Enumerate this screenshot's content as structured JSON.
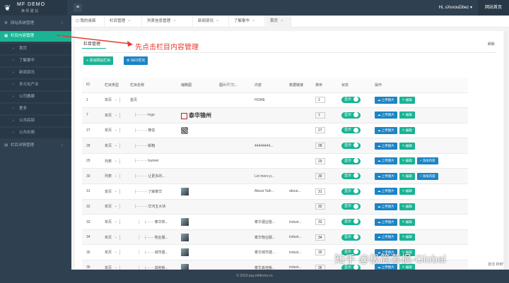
{
  "header": {
    "logo_text": "MF DEMO",
    "logo_sub": "美 帆 建 站",
    "menu_icon": "menu-icon",
    "user": "Hi, sXvxouDbez ▾",
    "site_home": "网站首页"
  },
  "sidebar": {
    "items": [
      {
        "label": "网站系统管理",
        "icon": "gear-icon",
        "arrow": "‹"
      },
      {
        "label": "栏目内容管理",
        "icon": "grid-icon",
        "arrow": "⌄"
      },
      {
        "label": "栏目详情管理",
        "icon": "list-icon",
        "arrow": "‹"
      }
    ],
    "subitems": [
      "首页",
      "了解泰华",
      "新闻资讯",
      "多元化产业",
      "公司搬建",
      "更多",
      "公共底部",
      "公共右侧"
    ]
  },
  "tabs": [
    {
      "label": "我的桌面",
      "icon": "home-icon"
    },
    {
      "label": "栏目管理"
    },
    {
      "label": "列表信息管理"
    },
    {
      "label": "新闻资讯"
    },
    {
      "label": "了解泰华"
    },
    {
      "label": "首页"
    }
  ],
  "panel": {
    "title": "栏目管理",
    "refresh": "刷新",
    "add_button": "+ 添加网站栏目",
    "seo_button": "SEO优化"
  },
  "annotation": "先点击栏目内容管理",
  "table": {
    "headers": [
      "ID",
      "栏目类型",
      "栏目名称",
      "缩略图",
      "图片尺寸(...",
      "内容",
      "数据链接",
      "排序",
      "状态",
      "操作"
    ],
    "rows": [
      {
        "id": "1",
        "type": "单页",
        "name": "首页",
        "indent": 0,
        "content": "HOME",
        "link": "",
        "sort": "1",
        "thumb": "",
        "add": false
      },
      {
        "id": "7",
        "type": "单页",
        "name": "logo",
        "indent": 1,
        "content": "",
        "link": "",
        "sort": "7",
        "thumb": "logo",
        "add": false
      },
      {
        "id": "27",
        "type": "单页",
        "name": "微信",
        "indent": 1,
        "content": "",
        "link": "",
        "sort": "27",
        "thumb": "qr",
        "add": false
      },
      {
        "id": "28",
        "type": "单页",
        "name": "邮箱",
        "indent": 1,
        "content": "44444444...",
        "link": "",
        "sort": "28",
        "thumb": "",
        "add": false
      },
      {
        "id": "29",
        "type": "列表",
        "name": "banner",
        "indent": 1,
        "content": "",
        "link": "",
        "sort": "29",
        "thumb": "",
        "add": true
      },
      {
        "id": "30",
        "type": "列表",
        "name": "让更多的...",
        "indent": 1,
        "content": "Let more p...",
        "link": "",
        "sort": "30",
        "thumb": "",
        "add": true
      },
      {
        "id": "31",
        "type": "单页",
        "name": "了解泰华",
        "indent": 1,
        "content": "About Taih...",
        "link": "about...",
        "sort": "31",
        "thumb": "photo",
        "add": false
      },
      {
        "id": "32",
        "type": "单页",
        "name": "华鸿五大块",
        "indent": 1,
        "content": "",
        "link": "",
        "sort": "32",
        "thumb": "",
        "add": false
      },
      {
        "id": "33",
        "type": "单页",
        "name": "泰华热...",
        "indent": 2,
        "content": "泰华烟业能...",
        "link": "indust...",
        "sort": "33",
        "thumb": "photo",
        "add": false
      },
      {
        "id": "34",
        "type": "单页",
        "name": "物业服...",
        "indent": 2,
        "content": "泰华物业服...",
        "link": "indust...",
        "sort": "34",
        "thumb": "photo",
        "add": false
      },
      {
        "id": "35",
        "type": "单页",
        "name": "城市建...",
        "indent": 2,
        "content": "泰华城市建...",
        "link": "indust...",
        "sort": "35",
        "thumb": "photo",
        "add": false
      },
      {
        "id": "36",
        "type": "单页",
        "name": "其他板...",
        "indent": 2,
        "content": "泰华其他板...",
        "link": "indust...",
        "sort": "36",
        "thumb": "photo",
        "add": false
      }
    ],
    "status_label": "显示",
    "upload_label": "上传图片",
    "edit_label": "编辑",
    "add_content_label": "+ 添加内容",
    "logo_thumb_text": "泰华锦州"
  },
  "footer": "© 2019 pay.mfdemo.cn",
  "watermark": "知乎 @极简慕枫-Global",
  "watermark_small": "激活\n转到\""
}
